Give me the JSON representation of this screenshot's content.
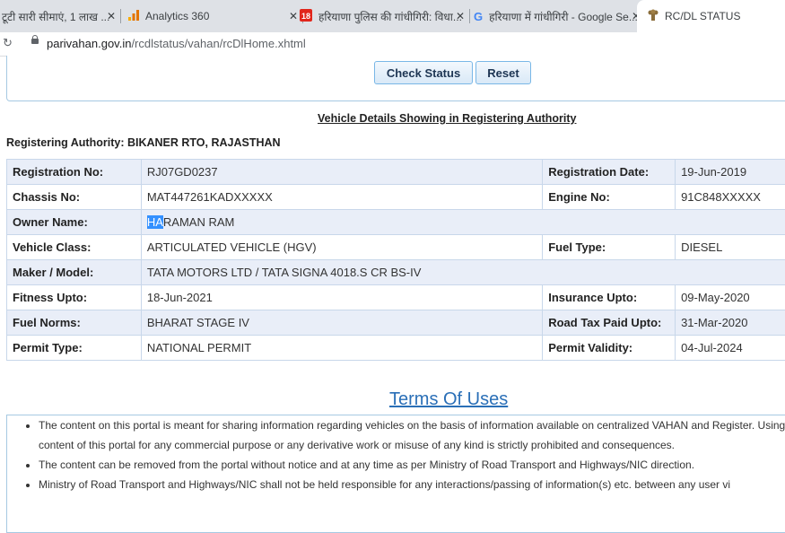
{
  "browser": {
    "tabs": [
      {
        "title": "टूटी सारी सीमाएं, 1 लाख ...",
        "icon": "news-icon"
      },
      {
        "title": "Analytics 360",
        "icon": "analytics-icon"
      },
      {
        "title": "हरियाणा पुलिस की गांधीगिरी: विधा...",
        "icon": "news18-icon"
      },
      {
        "title": "हरियाणा में गांधीगिरी - Google Se...",
        "icon": "google-icon"
      },
      {
        "title": "RC/DL STATUS",
        "icon": "emblem-icon"
      }
    ],
    "url_domain": "parivahan.gov.in",
    "url_path": "/rcdlstatus/vahan/rcDlHome.xhtml"
  },
  "form": {
    "check_label": "Check Status",
    "reset_label": "Reset"
  },
  "section_heading": "Vehicle Details Showing in Registering Authority",
  "authority_line": "Registering Authority: BIKANER RTO, RAJASTHAN",
  "details": {
    "reg_no_label": "Registration No:",
    "reg_no": "RJ07GD0237",
    "reg_date_label": "Registration Date:",
    "reg_date": "19-Jun-2019",
    "chassis_label": "Chassis No:",
    "chassis": "MAT447261KADXXXXX",
    "engine_label": "Engine No:",
    "engine": "91C848XXXXX",
    "owner_label": "Owner Name:",
    "owner_selected": "HA",
    "owner_rest": "RAMAN RAM",
    "class_label": "Vehicle Class:",
    "class": "ARTICULATED VEHICLE (HGV)",
    "fuel_label": "Fuel Type:",
    "fuel": "DIESEL",
    "maker_label": "Maker / Model:",
    "maker": "TATA MOTORS LTD / TATA SIGNA 4018.S CR BS-IV",
    "fitness_label": "Fitness Upto:",
    "fitness": "18-Jun-2021",
    "insurance_label": "Insurance Upto:",
    "insurance": "09-May-2020",
    "norms_label": "Fuel Norms:",
    "norms": "BHARAT STAGE IV",
    "tax_label": "Road Tax Paid Upto:",
    "tax": "31-Mar-2020",
    "permit_label": "Permit Type:",
    "permit": "NATIONAL PERMIT",
    "validity_label": "Permit Validity:",
    "validity": "04-Jul-2024"
  },
  "terms": {
    "title": "Terms Of Uses",
    "items": [
      "The content on this portal is meant for sharing information regarding vehicles on the basis of information available on centralized VAHAN and Register. Using content of this portal for any commercial purpose or any derivative work or misuse of any kind is strictly prohibited and consequences.",
      "The content can be removed from the portal without notice and at any time as per Ministry of Road Transport and Highways/NIC direction.",
      "Ministry of Road Transport and Highways/NIC shall not be held responsible for any interactions/passing of information(s) etc. between any user vi"
    ]
  }
}
